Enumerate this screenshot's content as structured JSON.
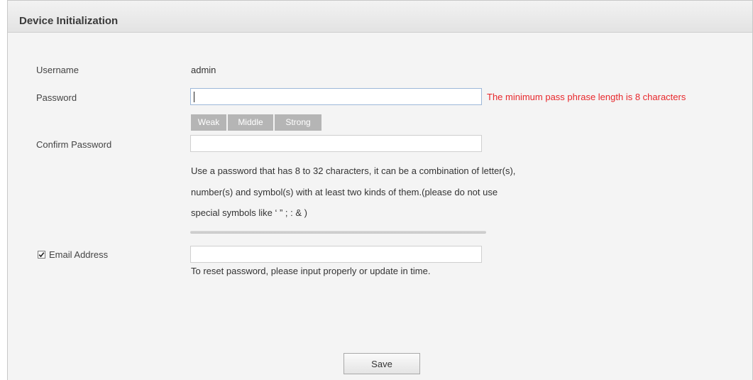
{
  "panel": {
    "title": "Device Initialization"
  },
  "form": {
    "username": {
      "label": "Username",
      "value": "admin"
    },
    "password": {
      "label": "Password",
      "value": "",
      "error": "The minimum pass phrase length is 8 characters",
      "strength_levels": [
        "Weak",
        "Middle",
        "Strong"
      ]
    },
    "confirm_password": {
      "label": "Confirm Password",
      "value": "",
      "hint_lines": [
        "Use a password that has 8 to 32 characters, it can be a combination of letter(s),",
        "number(s) and symbol(s) with at least two kinds of them.(please do not use",
        "special symbols like ‘ ” ; : & )"
      ]
    },
    "email": {
      "label": "Email Address",
      "checked": true,
      "value": "",
      "hint": "To reset password, please input properly or update in time."
    }
  },
  "actions": {
    "save_label": "Save"
  },
  "colors": {
    "error": "#e8272b",
    "strength_inactive": "#b5b5b5",
    "panel_background": "#f4f4f4"
  }
}
